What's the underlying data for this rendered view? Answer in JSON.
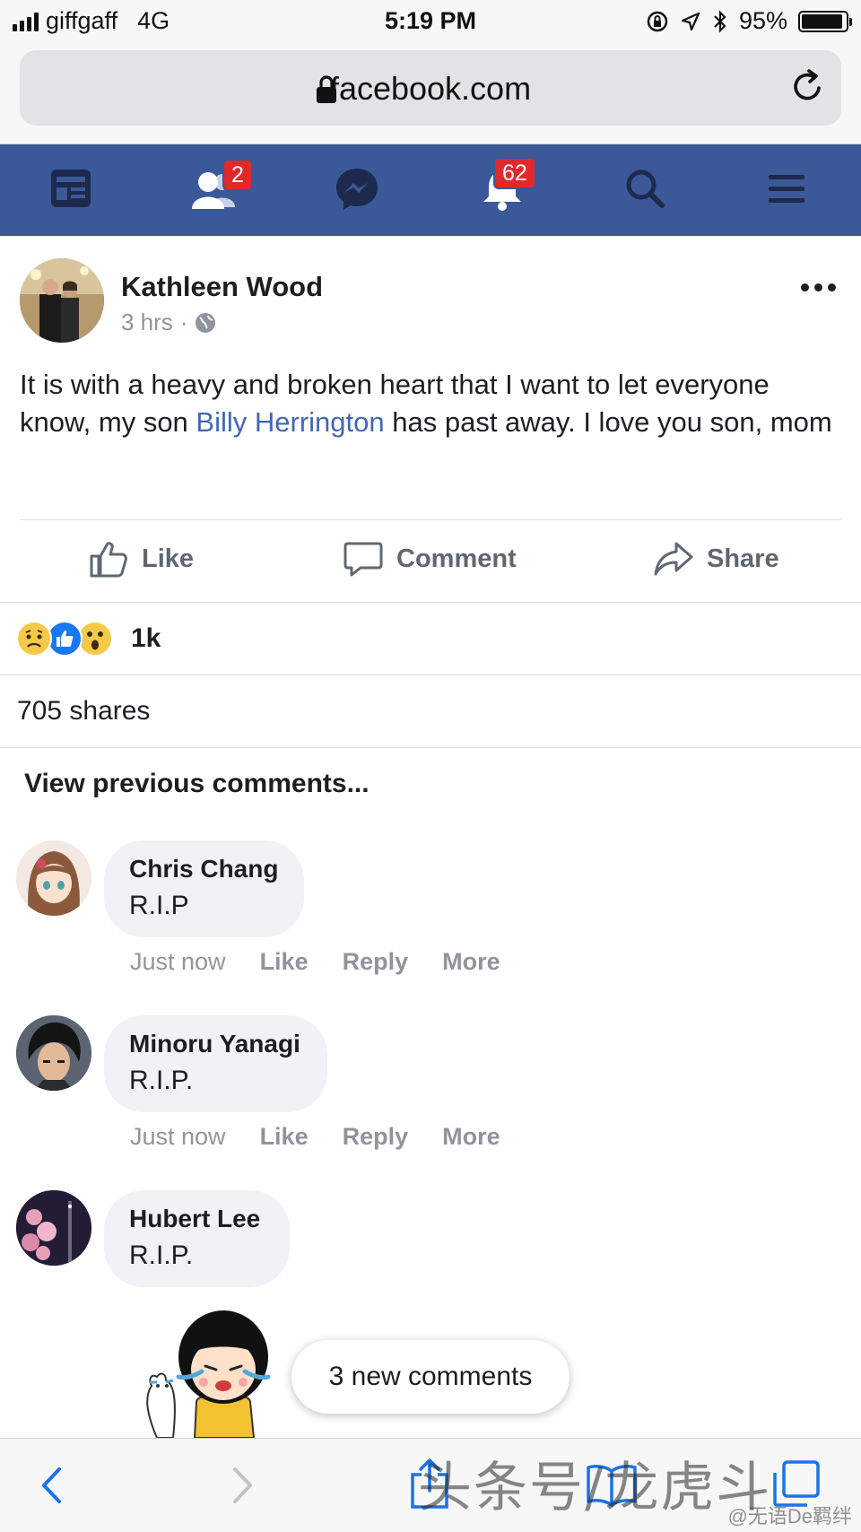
{
  "status_bar": {
    "carrier": "giffgaff",
    "network": "4G",
    "time": "5:19 PM",
    "battery_pct": "95%",
    "battery_level": 0.95
  },
  "browser": {
    "url": "facebook.com",
    "lock_icon": "lock-icon",
    "reload_icon": "reload-icon"
  },
  "fb_nav": {
    "items": [
      {
        "icon": "news-feed-icon"
      },
      {
        "icon": "friends-icon",
        "badge": "2"
      },
      {
        "icon": "messenger-icon"
      },
      {
        "icon": "notifications-icon",
        "badge": "62"
      },
      {
        "icon": "search-icon"
      },
      {
        "icon": "menu-icon"
      }
    ],
    "bg_color": "#3b5998"
  },
  "post": {
    "author": "Kathleen Wood",
    "time": "3 hrs",
    "separator": "·",
    "text_before": "It is with a heavy and broken heart that I want to let everyone know, my son ",
    "link": "Billy Herrington",
    "text_after": " has past away. I love you son, mom",
    "actions": {
      "like": "Like",
      "comment": "Comment",
      "share": "Share"
    },
    "reactions": [
      "sad",
      "like",
      "wow"
    ],
    "reaction_count": "1k",
    "shares": "705 shares",
    "view_previous": "View previous comments..."
  },
  "comments": [
    {
      "name": "Chris Chang",
      "text": "R.I.P",
      "time": "Just now",
      "like": "Like",
      "reply": "Reply",
      "more": "More"
    },
    {
      "name": "Minoru Yanagi",
      "text": "R.I.P.",
      "time": "Just now",
      "like": "Like",
      "reply": "Reply",
      "more": "More"
    },
    {
      "name": "Hubert Lee",
      "text": "R.I.P."
    }
  ],
  "new_comments": "3 new comments",
  "toolbar": {
    "back": "‹",
    "forward": "›"
  },
  "watermark": {
    "main": "头条号/龙虎斗",
    "secondary": "@无语De羁绊"
  }
}
